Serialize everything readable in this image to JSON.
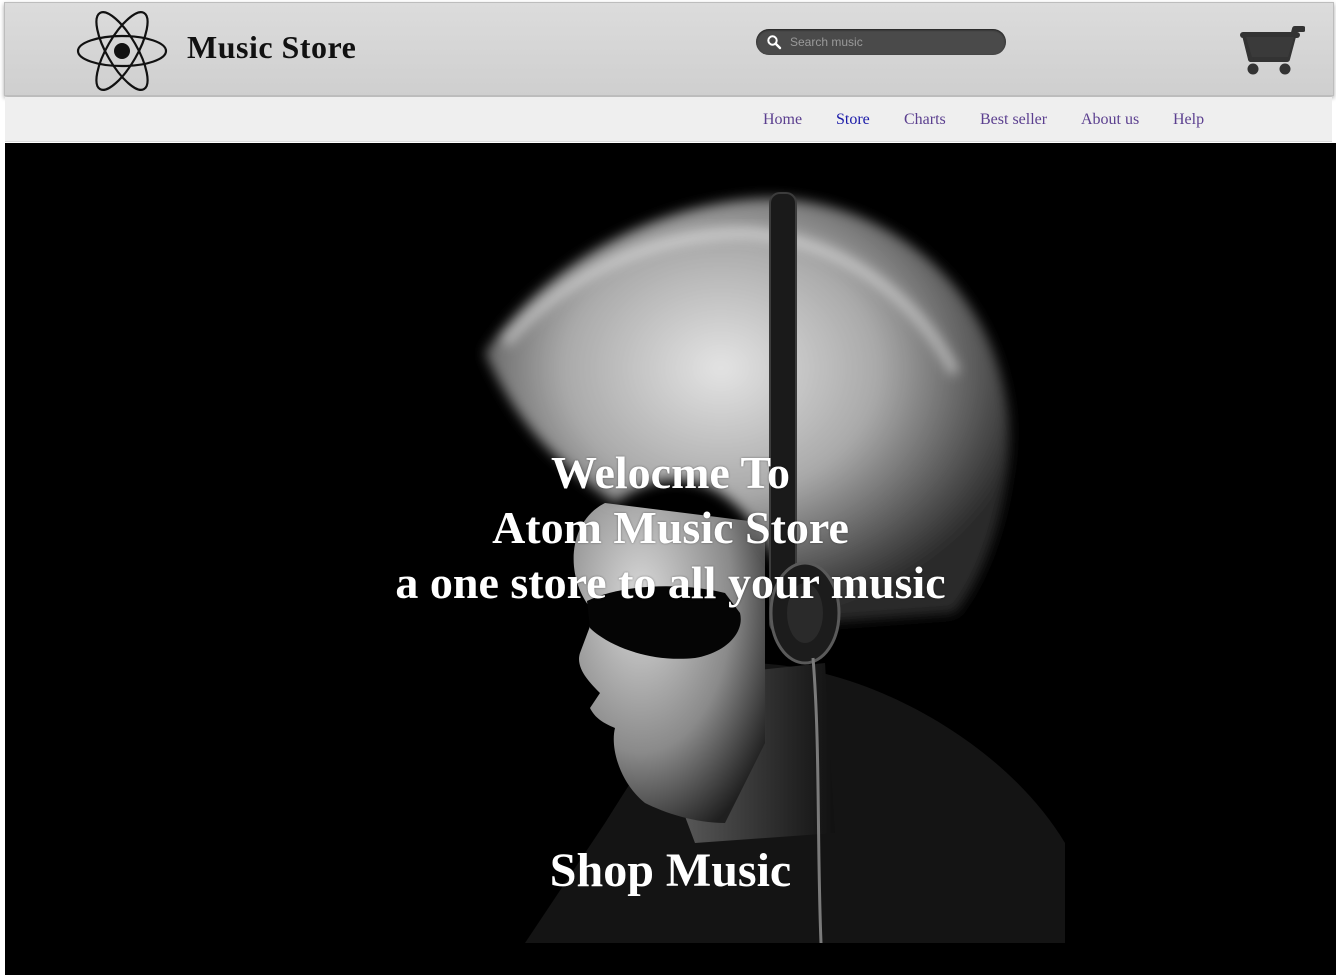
{
  "header": {
    "brand": "Music Store",
    "logo_icon": "atom-icon",
    "search": {
      "placeholder": "Search music",
      "value": "",
      "icon": "search-icon"
    },
    "cart_icon": "shopping-cart-icon"
  },
  "nav": {
    "items": [
      {
        "label": "Home",
        "active": false
      },
      {
        "label": "Store",
        "active": true
      },
      {
        "label": "Charts",
        "active": false
      },
      {
        "label": "Best seller",
        "active": false
      },
      {
        "label": "About us",
        "active": false
      },
      {
        "label": "Help",
        "active": false
      }
    ]
  },
  "hero": {
    "line1": "Welocme To",
    "line2": "Atom Music Store",
    "line3": "a one store to all your music",
    "cta": "Shop Music"
  },
  "colors": {
    "header_bg": "#d4d4d4",
    "nav_bg": "#efefef",
    "nav_link": "#5b3f8f",
    "nav_active": "#1a1aa8",
    "hero_bg": "#000000",
    "hero_text": "#ffffff"
  }
}
